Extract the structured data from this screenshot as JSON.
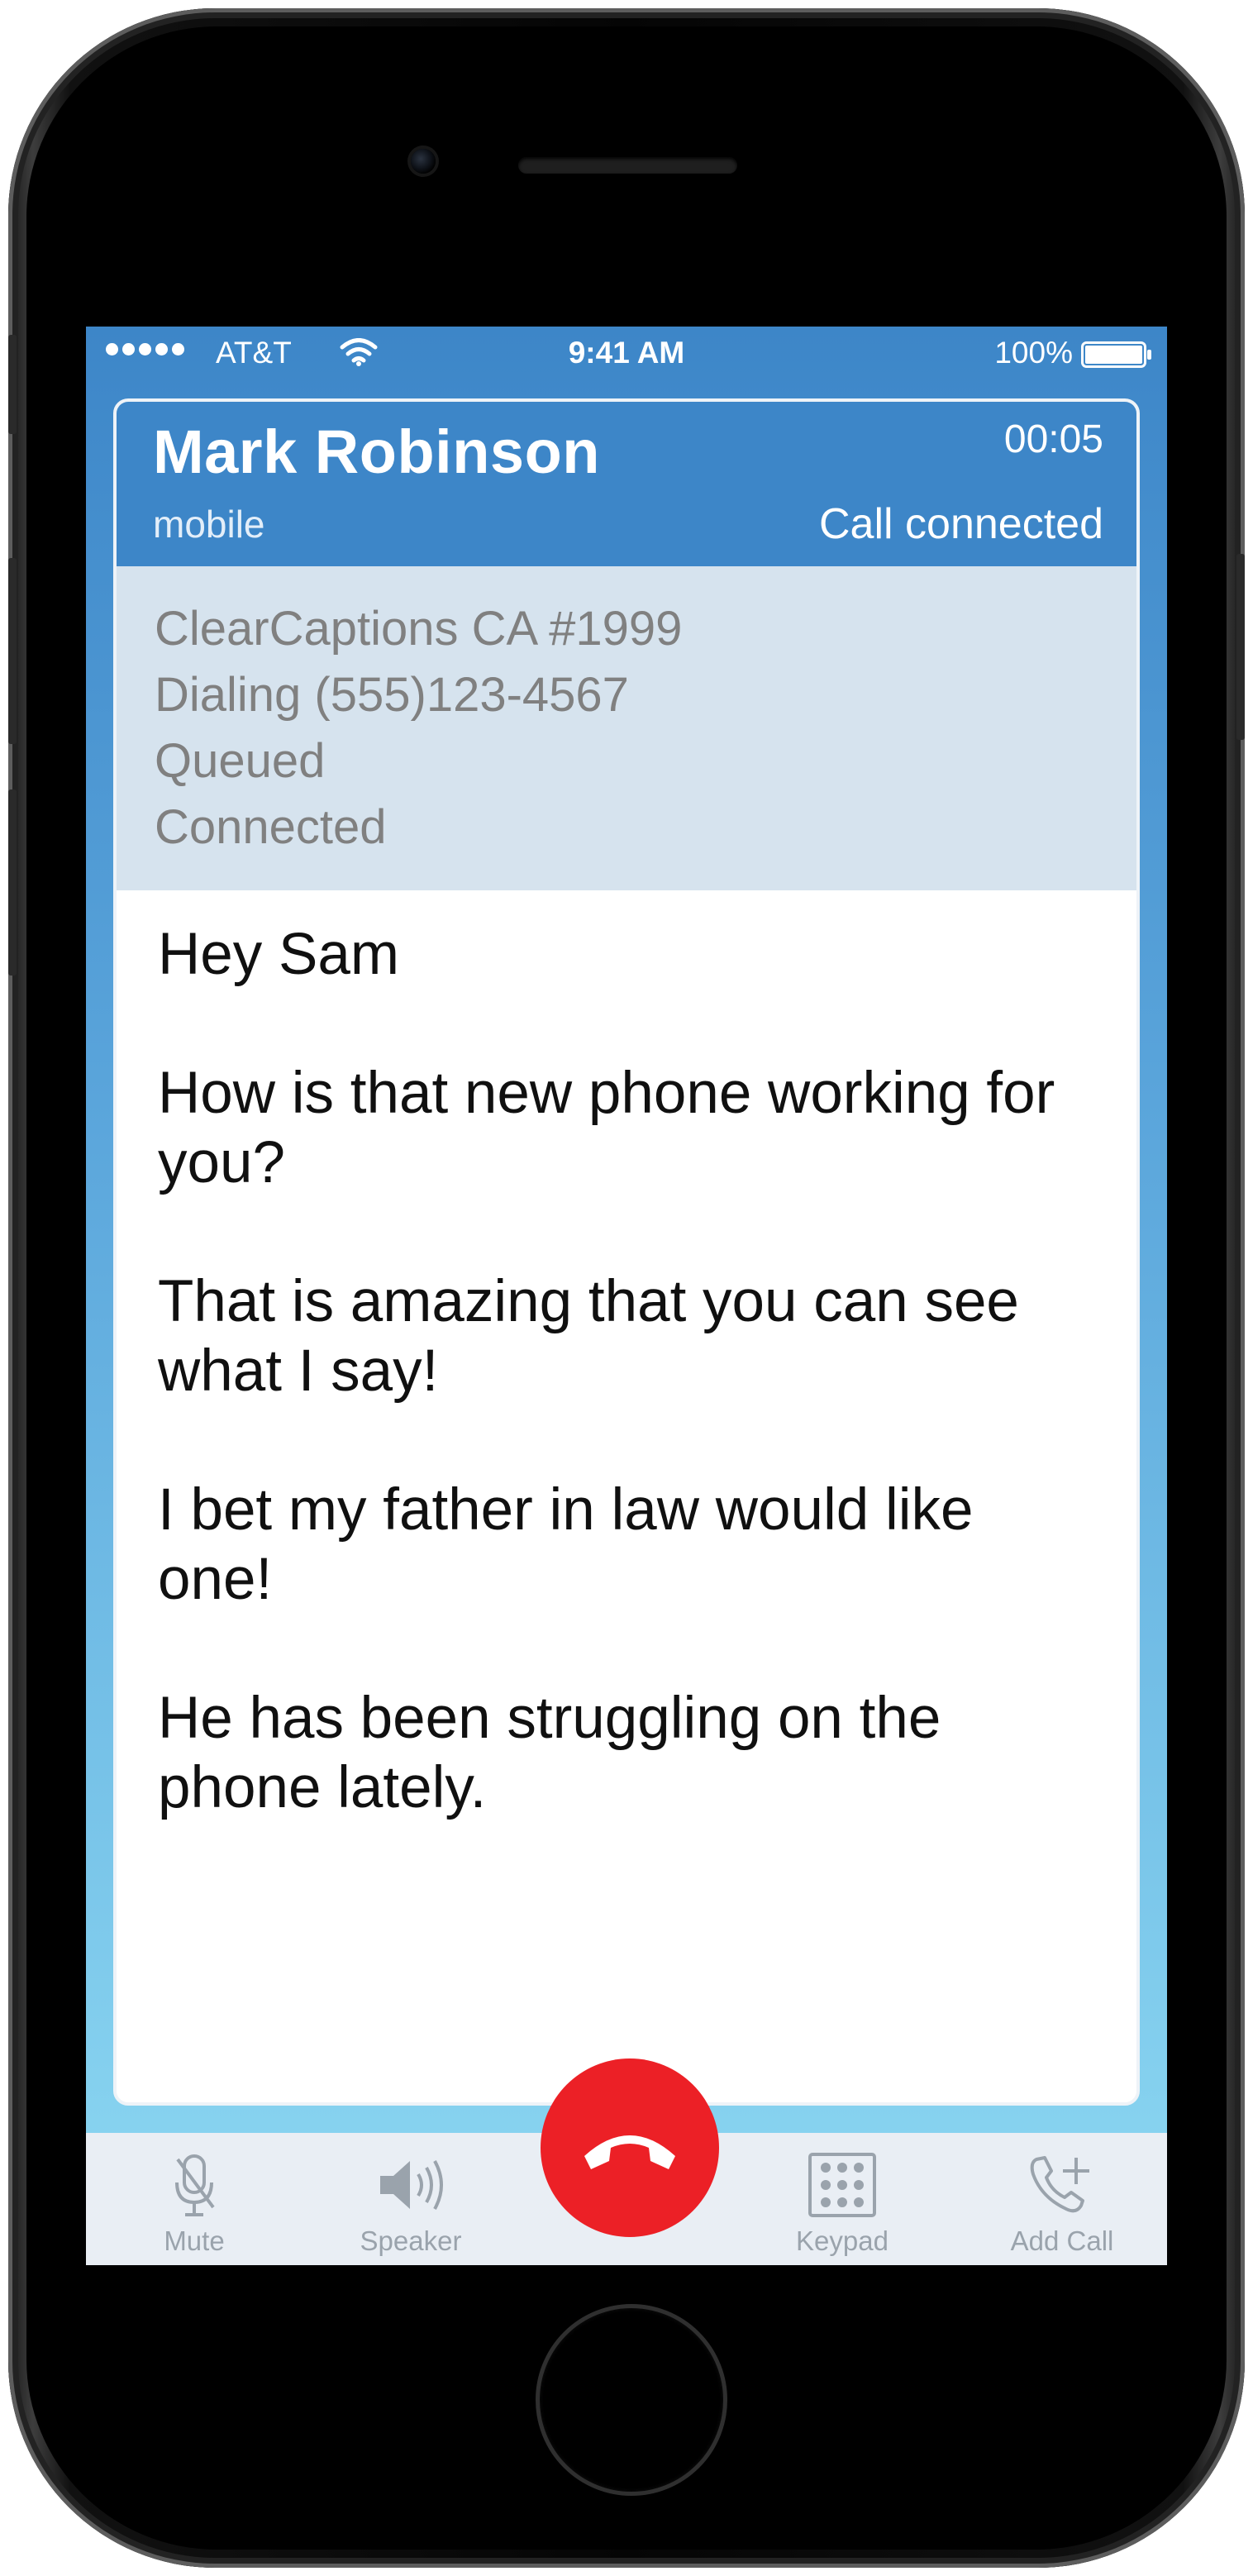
{
  "status_bar": {
    "carrier": "AT&T",
    "time": "9:41 AM",
    "battery_percent": "100%",
    "signal_bars": 5,
    "battery_level": 1.0
  },
  "call": {
    "caller_name": "Mark Robinson",
    "caller_type": "mobile",
    "timer": "00:05",
    "status": "Call connected"
  },
  "progress_log": [
    "ClearCaptions CA #1999",
    "Dialing (555)123-4567",
    "Queued",
    "Connected"
  ],
  "captions": [
    "Hey Sam",
    "How is that new phone working for you?",
    "That is amazing that you can see what I say!",
    "I bet my father in law would like one!",
    "He has been struggling on the phone lately."
  ],
  "controls": {
    "mute_label": "Mute",
    "speaker_label": "Speaker",
    "keypad_label": "Keypad",
    "add_call_label": "Add Call"
  },
  "colors": {
    "header_blue": "#3d86c8",
    "progress_bg": "#d6e3ee",
    "end_call_red": "#ec2026",
    "control_gray": "#9aa3ac"
  },
  "icons": {
    "mute": "microphone-icon",
    "speaker": "speaker-icon",
    "keypad": "keypad-icon",
    "add_call": "add-call-icon",
    "end_call": "end-call-icon"
  }
}
